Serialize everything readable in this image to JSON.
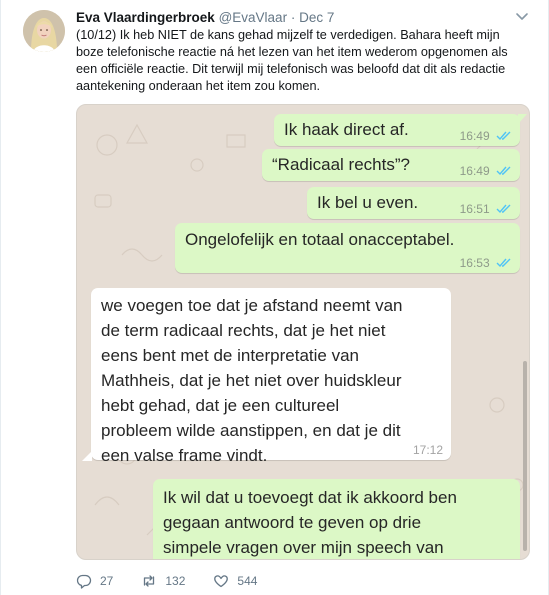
{
  "author": {
    "name": "Eva Vlaardingerbroek",
    "handle": "@EvaVlaar",
    "separator": "·",
    "date": "Dec 7",
    "avatar_icon": "profile-photo"
  },
  "tweet": {
    "lines": [
      "(10/12) Ik heb NIET de kans gehad mijzelf te verdedigen. Bahara heeft mijn",
      "boze telefonische reactie ná het lezen van het item wederom opgenomen als",
      "een officiële reactie. Dit terwijl mij telefonisch was beloofd dat dit als redactie",
      "aantekening onderaan het item zou komen."
    ]
  },
  "chat": {
    "colors": {
      "outgoing": "#dcf8c6",
      "incoming": "#ffffff",
      "background": "#e6ddd4",
      "read_ticks": "#4fc3f7"
    },
    "messages": [
      {
        "direction": "out",
        "lines": [
          "Ik haak direct af."
        ],
        "time": "16:49",
        "status": "read"
      },
      {
        "direction": "out",
        "lines": [
          "“Radicaal rechts”?"
        ],
        "time": "16:49",
        "status": "read"
      },
      {
        "direction": "out",
        "lines": [
          "Ik bel u even."
        ],
        "time": "16:51",
        "status": "read"
      },
      {
        "direction": "out",
        "lines": [
          "Ongelofelijk en totaal onacceptabel."
        ],
        "time": "16:53",
        "status": "read"
      },
      {
        "direction": "in",
        "lines": [
          "we voegen toe dat je afstand neemt van",
          "de term radicaal rechts, dat je het niet",
          "eens bent met de interpretatie van",
          "Mathheis, dat je het niet over huidskleur",
          "hebt gehad, dat je een cultureel",
          "probleem wilde aanstippen, en dat je dit",
          "een valse frame vindt."
        ],
        "time": "17:12"
      },
      {
        "direction": "out",
        "lines": [
          "Ik wil dat u toevoegt dat ik akkoord ben",
          "gegaan antwoord te geven op drie",
          "simpele vragen over mijn speech van"
        ],
        "time": ""
      }
    ]
  },
  "actions": {
    "reply": {
      "icon": "reply-icon",
      "count": "27"
    },
    "retweet": {
      "icon": "retweet-icon",
      "count": "132"
    },
    "like": {
      "icon": "heart-icon",
      "count": "544"
    }
  }
}
